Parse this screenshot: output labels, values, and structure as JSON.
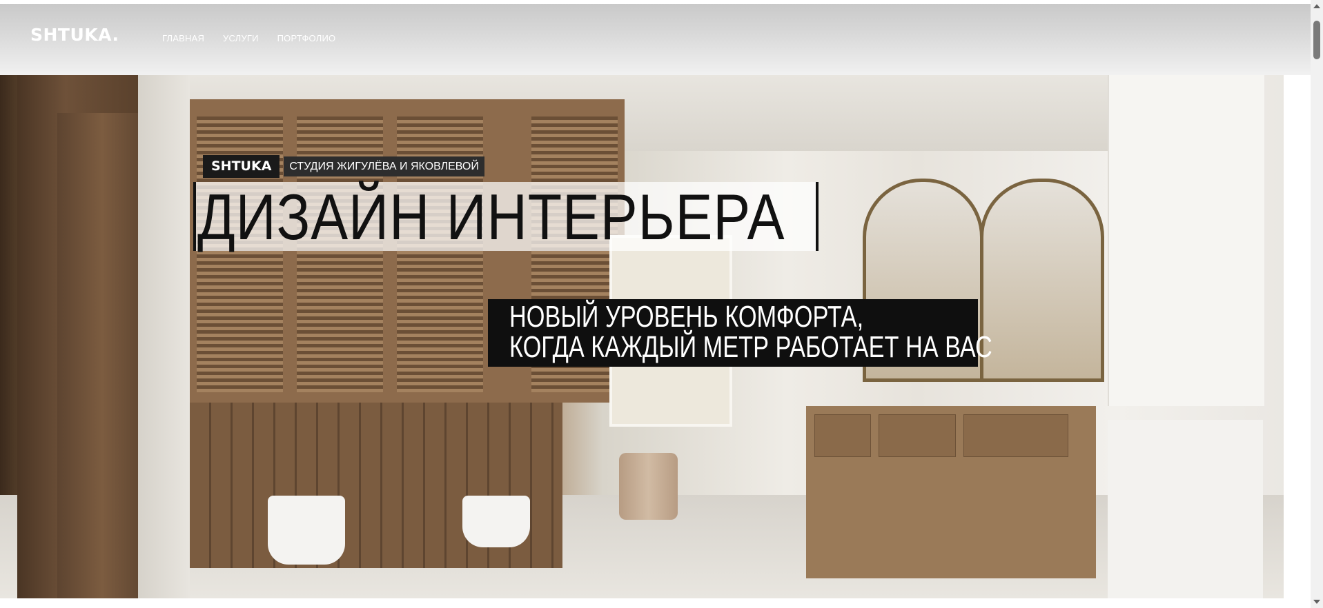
{
  "header": {
    "logo": "SHTUKA.",
    "nav": [
      {
        "label": "ГЛАВНАЯ"
      },
      {
        "label": "УСЛУГИ"
      },
      {
        "label": "ПОРТФОЛИО"
      }
    ]
  },
  "hero": {
    "brand": "SHTUKA",
    "studio": "СТУДИЯ ЖИГУЛЁВА И ЯКОВЛЕВОЙ",
    "headline": "ДИЗАЙН ИНТЕРЬЕРА",
    "subline_1": "НОВЫЙ УРОВЕНЬ КОМФОРТА,",
    "subline_2": "КОГДА КАЖДЫЙ МЕТР РАБОТАЕТ НА ВАС"
  },
  "colors": {
    "header_gradient_top": "#c9c9c9",
    "header_gradient_bottom": "#f1f1f1",
    "tag_background": "#1a1a1a",
    "subline_background": "#0f0f0f",
    "text_light": "#ffffff",
    "text_dark": "#111111"
  },
  "icons": {
    "scroll_up": "chevron-up-icon",
    "scroll_down": "chevron-down-icon"
  }
}
